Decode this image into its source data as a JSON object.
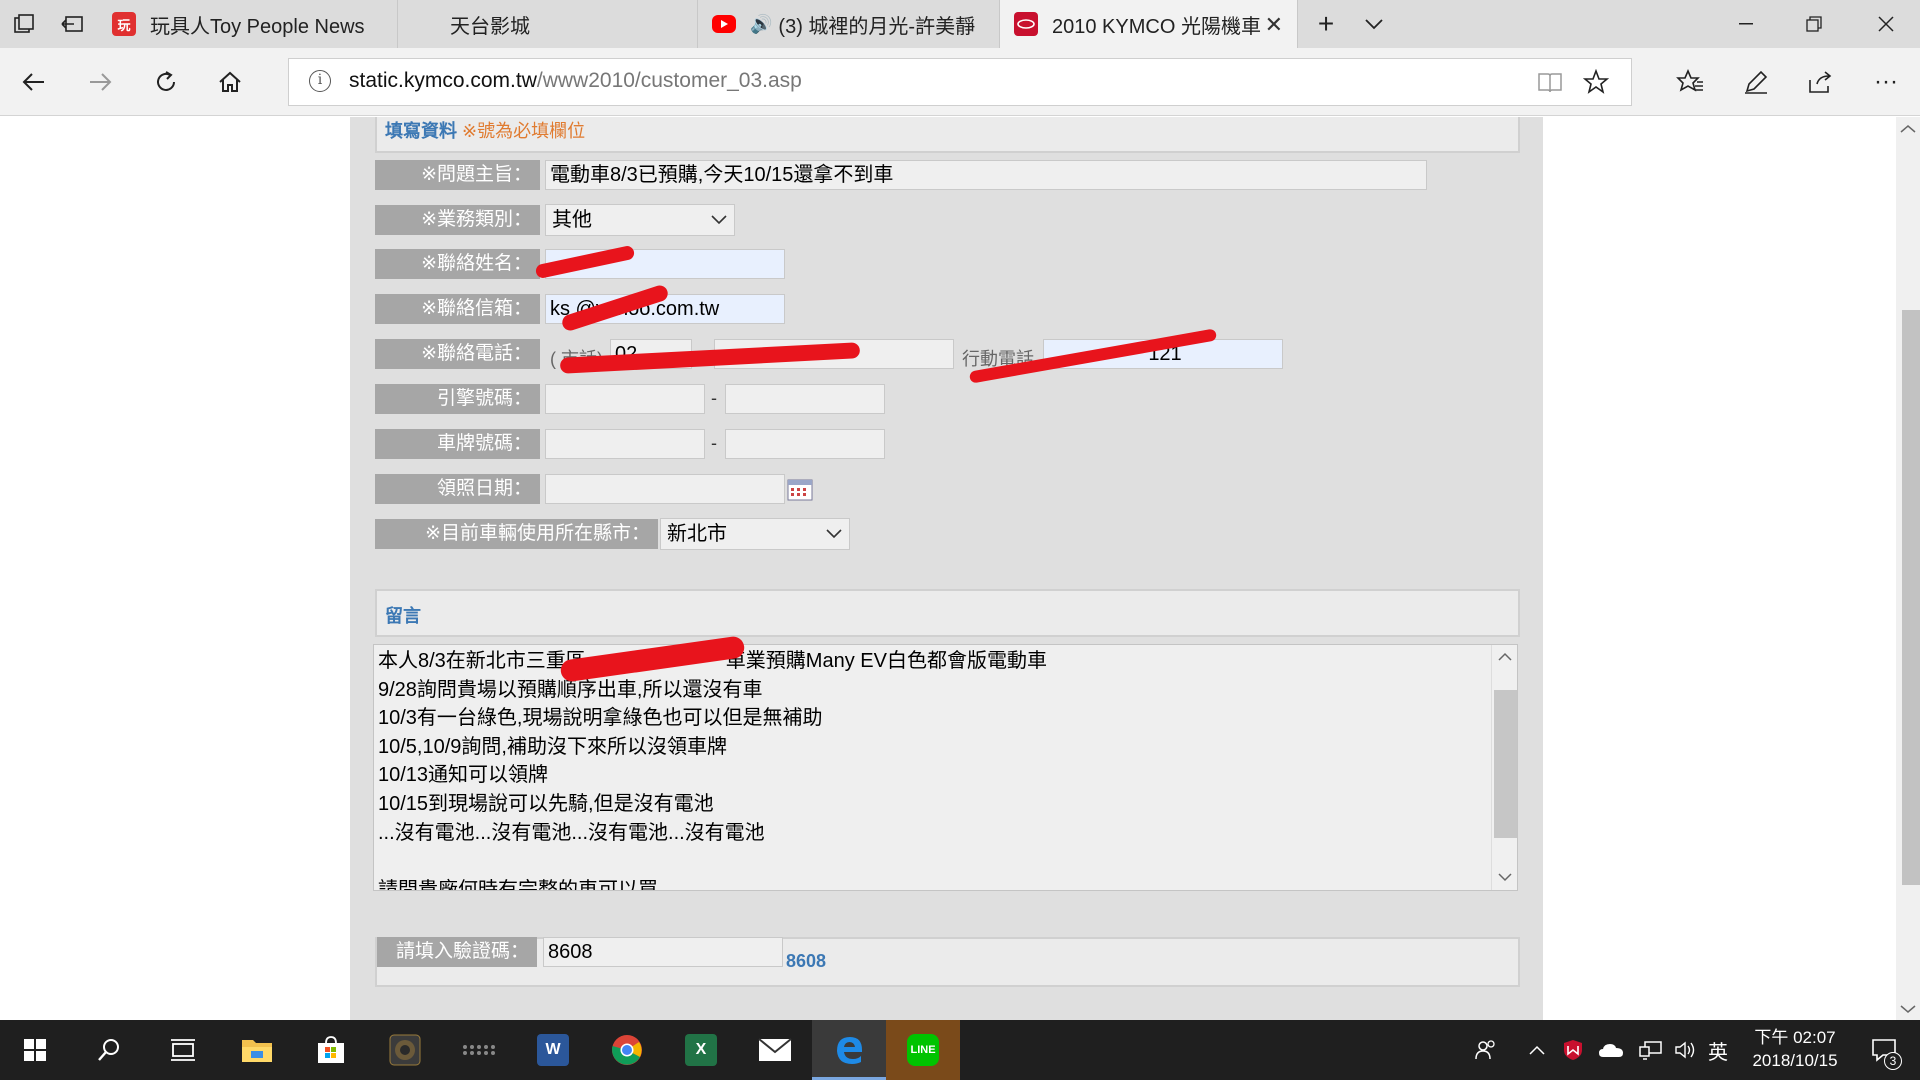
{
  "browser": {
    "tabs": [
      {
        "title": "玩具人Toy People News",
        "favicon": "玩"
      },
      {
        "title": "天台影城"
      },
      {
        "title": "(3) 城裡的月光-許美靜",
        "audio": "🔊"
      },
      {
        "title": "2010 KYMCO 光陽機車"
      }
    ],
    "url_host": "static.kymco.com.tw",
    "url_path": "/www2010/customer_03.asp"
  },
  "form": {
    "section_title": "填寫資料",
    "required_note": "※號為必填欄位",
    "subject_label": "※問題主旨：",
    "subject_value": "電動車8/3已預購,今天10/15還拿不到車",
    "category_label": "※業務類別：",
    "category_value": "其他",
    "name_label": "※聯絡姓名：",
    "name_value": "",
    "email_label": "※聯絡信箱：",
    "email_value": "ks         @yahoo.com.tw",
    "phone_label": "※聯絡電話：",
    "landline_prefix": "( 市話)",
    "landline_value": "02",
    "mobile_label": "行動電話",
    "mobile_value": "121",
    "engine_label": "引擎號碼：",
    "plate_label": "車牌號碼：",
    "license_date_label": "領照日期：",
    "dash": "-",
    "city_label": "※目前車輛使用所在縣市：",
    "city_value": "新北市"
  },
  "message": {
    "title": "留言",
    "lines": [
      "本人8/3在新北市三重區　　　　　　　車業預購Many EV白色都會版電動車",
      "9/28詢問貴場以預購順序出車,所以還沒有車",
      "10/3有一台綠色,現場說明拿綠色也可以但是無補助",
      "10/5,10/9詢問,補助沒下來所以沒領車牌",
      "10/13通知可以領牌",
      "10/15到現場說可以先騎,但是沒有電池",
      "...沒有電池...沒有電池...沒有電池...沒有電池",
      "",
      "請問貴廠何時有完整的車可以買"
    ]
  },
  "captcha": {
    "label": "請填入驗證碼：",
    "value": "8608",
    "code": "8608"
  },
  "taskbar": {
    "ime": "英",
    "time": "下午 02:07",
    "date": "2018/10/15",
    "notif_count": "3"
  }
}
